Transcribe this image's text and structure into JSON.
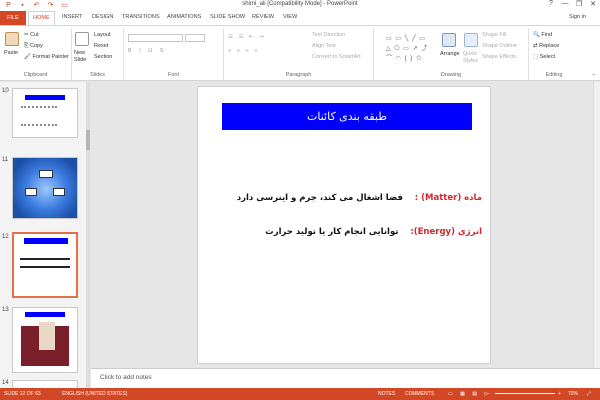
{
  "window": {
    "title": "shimi_ali [Compatibility Mode] - PowerPoint",
    "signin": "Sign in",
    "controls": [
      "?",
      "—",
      "❐",
      "✕"
    ]
  },
  "tabs": [
    {
      "label": "FILE"
    },
    {
      "label": "HOME"
    },
    {
      "label": "INSERT"
    },
    {
      "label": "DESIGN"
    },
    {
      "label": "TRANSITIONS"
    },
    {
      "label": "ANIMATIONS"
    },
    {
      "label": "SLIDE SHOW"
    },
    {
      "label": "REVIEW"
    },
    {
      "label": "VIEW"
    }
  ],
  "ribbon": {
    "clipboard": {
      "label": "Clipboard",
      "paste": "Paste",
      "cut": "Cut",
      "copy": "Copy",
      "painter": "Format Painter"
    },
    "slides": {
      "label": "Slides",
      "new_slide": "New Slide",
      "layout": "Layout",
      "reset": "Reset",
      "section": "Section"
    },
    "font": {
      "label": "Font"
    },
    "paragraph": {
      "label": "Paragraph",
      "text_direction": "Text Direction",
      "align_text": "Align Text",
      "smartart": "Convert to SmartArt"
    },
    "drawing": {
      "label": "Drawing",
      "arrange": "Arrange",
      "quick_styles": "Quick Styles",
      "shape_fill": "Shape Fill",
      "shape_outline": "Shape Outline",
      "shape_effects": "Shape Effects"
    },
    "editing": {
      "label": "Editing",
      "find": "Find",
      "replace": "Replace",
      "select": "Select"
    }
  },
  "thumbnails": [
    {
      "num": "10"
    },
    {
      "num": "11"
    },
    {
      "num": "12"
    },
    {
      "num": "13"
    },
    {
      "num": "14"
    }
  ],
  "slide": {
    "title": "طبقه بندی کائنات",
    "line1_label": "ماده (Matter) :",
    "line1_text": "فضا اشغال می کند، جرم و اینرسی دارد",
    "line2_label": "انرژی (Energy):",
    "line2_text": "توانایی انجام کار یا تولید حرارت"
  },
  "notes_placeholder": "Click to add notes",
  "status": {
    "slide_info": "SLIDE 12 OF 63",
    "language": "ENGLISH (UNITED STATES)",
    "notes": "NOTES",
    "comments": "COMMENTS",
    "zoom": "70%"
  },
  "colors": {
    "accent": "#d24726",
    "slide_title_bg": "#0000ff",
    "label_red": "#d5262c"
  }
}
